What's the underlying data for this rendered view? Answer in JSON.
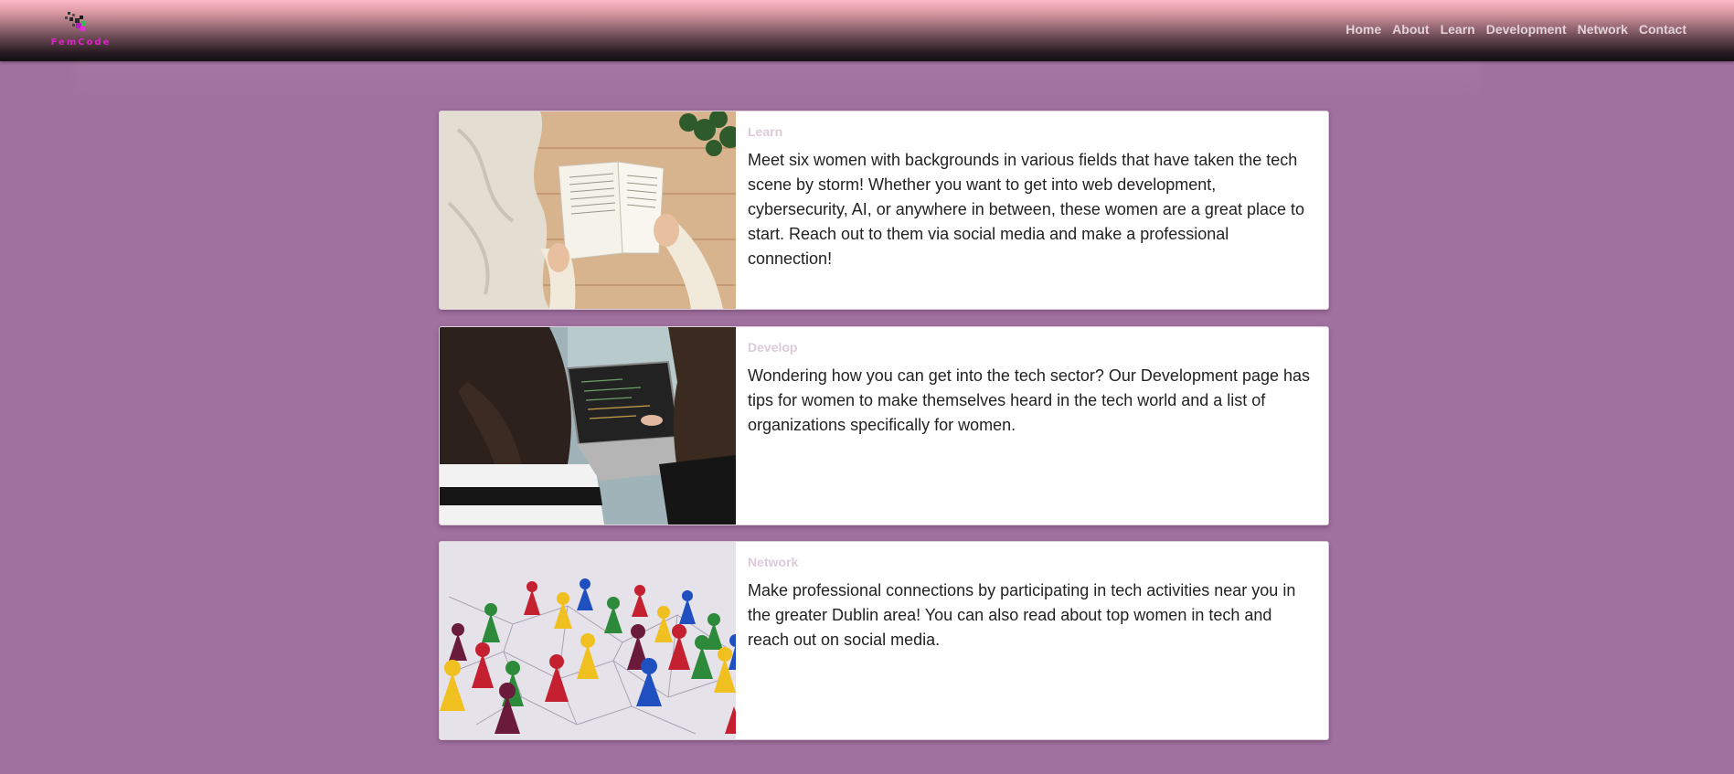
{
  "header": {
    "logo_text": "FemCode",
    "nav": [
      "Home",
      "About",
      "Learn",
      "Development",
      "Network",
      "Contact"
    ]
  },
  "cards": [
    {
      "category": "Learn",
      "image": "woman-reading-book-photo",
      "text": "Meet six women with backgrounds in various fields that have taken the tech scene by storm! Whether you want to get into web development, cybersecurity, AI, or anywhere in between, these women are a great place to start. Reach out to them via social media and make a professional connection!"
    },
    {
      "category": "Develop",
      "image": "women-at-laptop-coding-photo",
      "text": "Wondering how you can get into the tech sector? Our Development page has tips for women to make themselves heard in the tech world and a list of organizations specifically for women."
    },
    {
      "category": "Network",
      "image": "connected-game-pieces-photo",
      "text": "Make professional connections by participating in tech activities near you in the greater Dublin area! You can also read about top women in tech and reach out on social media."
    }
  ],
  "colors": {
    "page_background": "#a0709f",
    "header_top": "#ffb9c8",
    "header_bottom": "#141012",
    "logo_text": "#e020c8",
    "nav_text": "#e4d2da",
    "card_category": "#dccbd6",
    "card_text": "#222222"
  }
}
